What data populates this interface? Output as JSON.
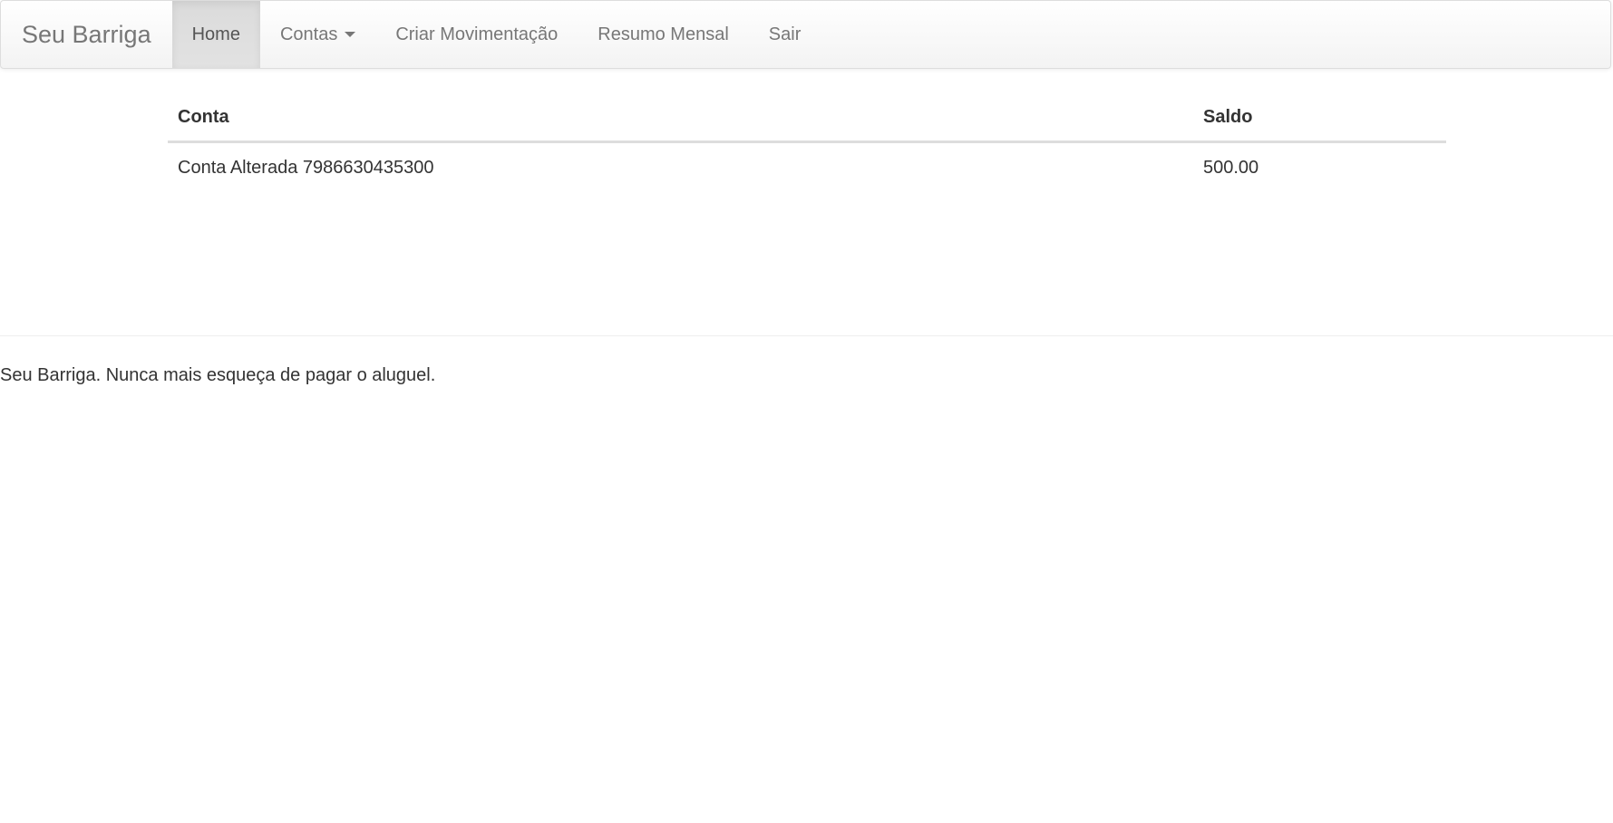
{
  "navbar": {
    "brand": "Seu Barriga",
    "items": [
      {
        "label": "Home",
        "active": true
      },
      {
        "label": "Contas",
        "dropdown": true
      },
      {
        "label": "Criar Movimentação"
      },
      {
        "label": "Resumo Mensal"
      },
      {
        "label": "Sair"
      }
    ]
  },
  "table": {
    "headers": [
      "Conta",
      "Saldo"
    ],
    "rows": [
      {
        "conta": "Conta Alterada 7986630435300",
        "saldo": "500.00"
      }
    ]
  },
  "footer": {
    "text": "Seu Barriga. Nunca mais esqueça de pagar o aluguel."
  },
  "colors": {
    "navbar_bg": "#f8f8f8",
    "active_bg": "#e0e0e0",
    "nav_text": "#777777",
    "body_text": "#333333"
  },
  "icons": {
    "contas_dropdown": "caret-down-icon"
  }
}
